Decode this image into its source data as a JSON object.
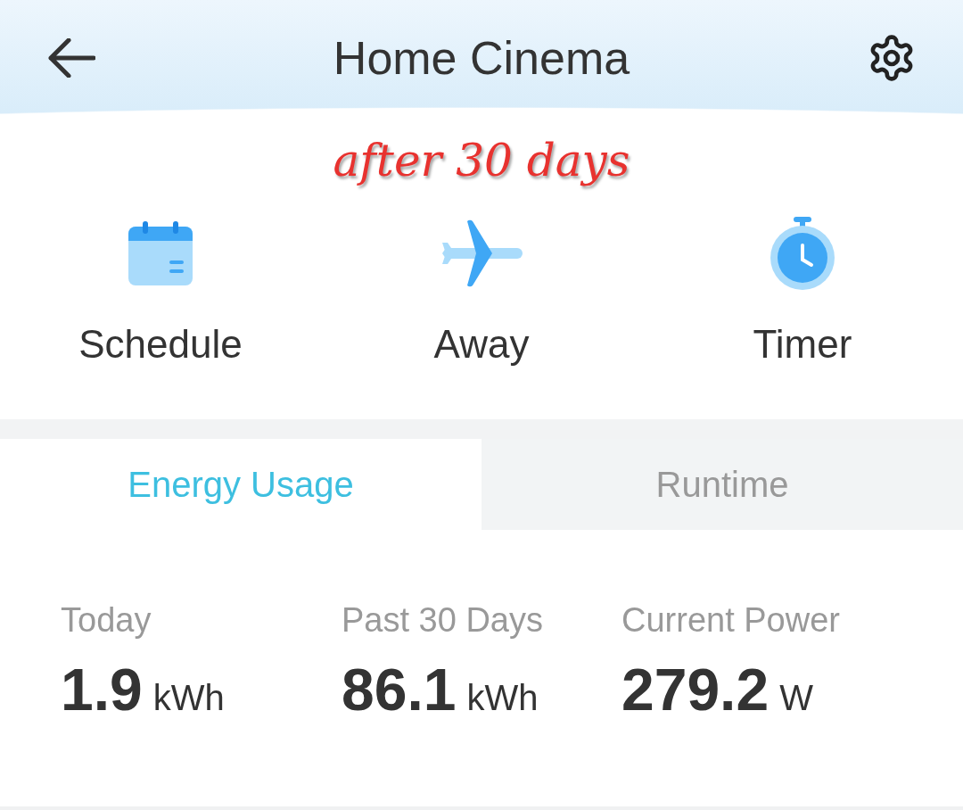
{
  "header": {
    "title": "Home Cinema"
  },
  "annotation": "after 30 days",
  "actions": [
    {
      "kind": "schedule",
      "label": "Schedule"
    },
    {
      "kind": "away",
      "label": "Away"
    },
    {
      "kind": "timer",
      "label": "Timer"
    }
  ],
  "tabs": [
    {
      "label": "Energy Usage",
      "selected": true
    },
    {
      "label": "Runtime",
      "selected": false
    }
  ],
  "stats": [
    {
      "label": "Today",
      "value": "1.9",
      "unit": "kWh"
    },
    {
      "label": "Past 30 Days",
      "value": "86.1",
      "unit": "kWh"
    },
    {
      "label": "Current Power",
      "value": "279.2",
      "unit": "W"
    }
  ]
}
